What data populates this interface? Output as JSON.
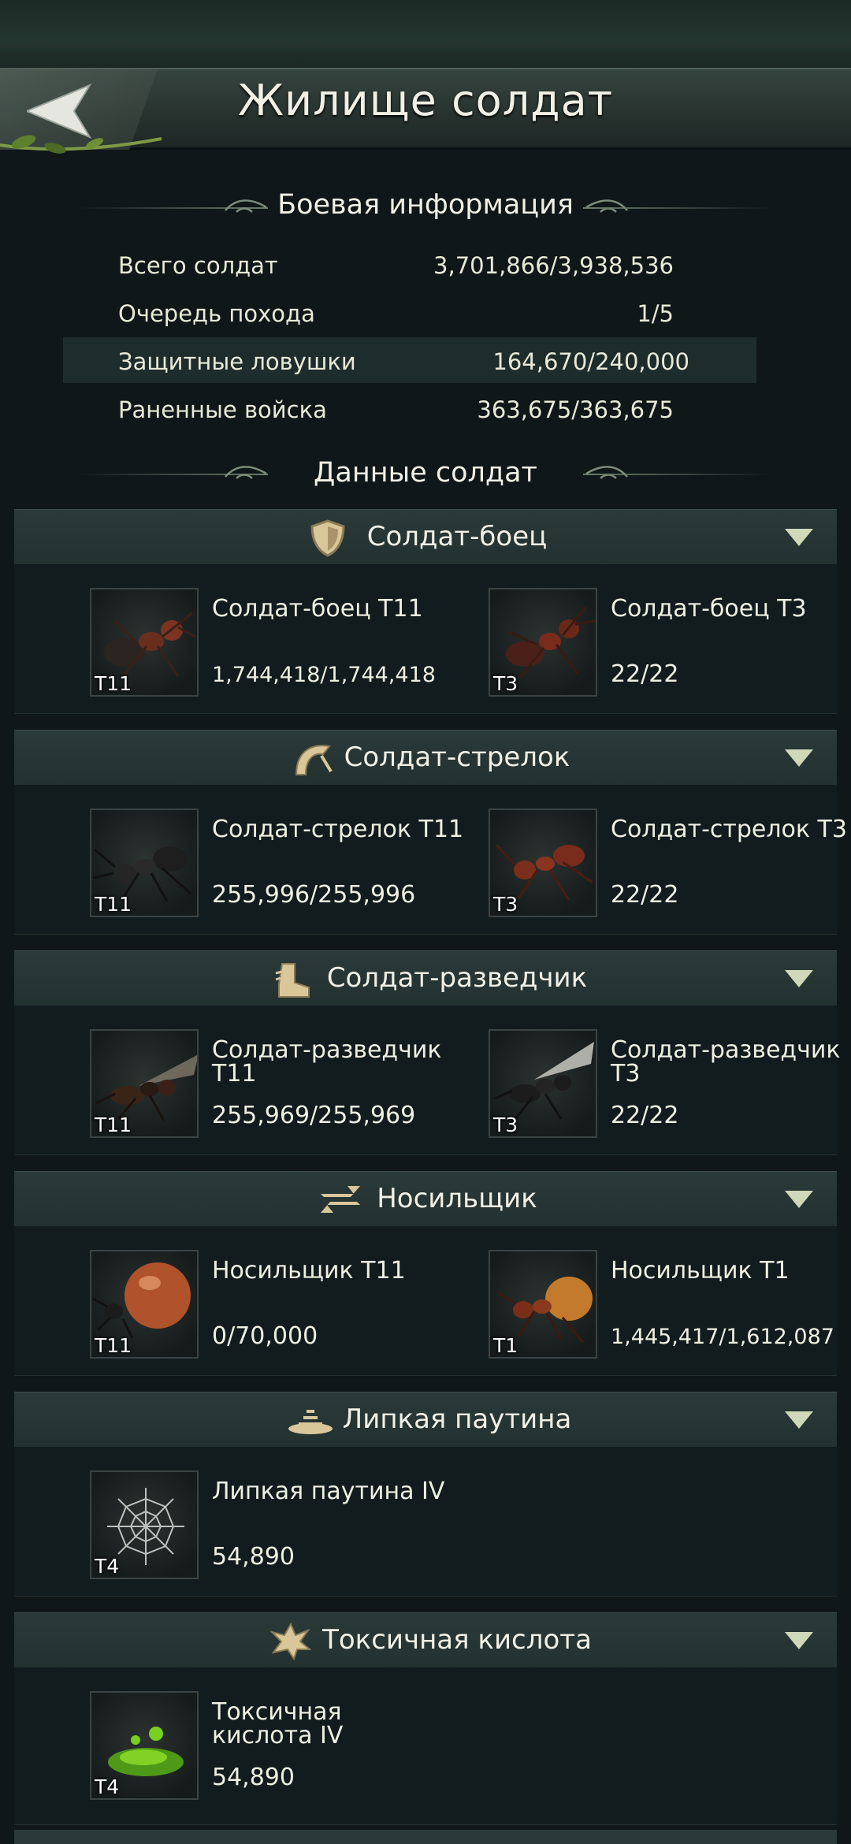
{
  "header": {
    "title": "Жилище солдат",
    "back_icon": "back-arrow-icon"
  },
  "battle_info": {
    "heading": "Боевая информация",
    "rows": [
      {
        "label": "Всего солдат",
        "value": "3,701,866/3,938,536"
      },
      {
        "label": "Очередь похода",
        "value": "1/5"
      },
      {
        "label": "Защитные ловушки",
        "value": "164,670/240,000"
      },
      {
        "label": "Раненные войска",
        "value": "363,675/363,675"
      }
    ]
  },
  "soldier_data": {
    "heading": "Данные солдат"
  },
  "categories": [
    {
      "title": "Солдат-боец",
      "icon": "shield-icon",
      "units": [
        {
          "name": "Солдат-боец T11",
          "count": "1,744,418/1,744,418",
          "tier": "T11"
        },
        {
          "name": "Солдат-боец T3",
          "count": "22/22",
          "tier": "T3"
        }
      ]
    },
    {
      "title": "Солдат-стрелок",
      "icon": "bow-icon",
      "units": [
        {
          "name": "Солдат-стрелок T11",
          "count": "255,996/255,996",
          "tier": "T11"
        },
        {
          "name": "Солдат-стрелок T3",
          "count": "22/22",
          "tier": "T3"
        }
      ]
    },
    {
      "title": "Солдат-разведчик",
      "icon": "boot-icon",
      "units": [
        {
          "name": "Солдат-разведчик T11",
          "count": "255,969/255,969",
          "tier": "T11"
        },
        {
          "name": "Солдат-разведчик T3",
          "count": "22/22",
          "tier": "T3"
        }
      ]
    },
    {
      "title": "Носильщик",
      "icon": "transfer-arrows-icon",
      "units": [
        {
          "name": "Носильщик T11",
          "count": "0/70,000",
          "tier": "T11"
        },
        {
          "name": "Носильщик T1",
          "count": "1,445,417/1,612,087",
          "tier": "T1"
        }
      ]
    },
    {
      "title": "Липкая паутина",
      "icon": "web-trap-icon",
      "units": [
        {
          "name": "Липкая паутина IV",
          "count": "54,890",
          "tier": "T4"
        }
      ]
    },
    {
      "title": "Токсичная кислота",
      "icon": "acid-splash-icon",
      "units": [
        {
          "name": "Токсичная кислота IV",
          "count": "54,890",
          "tier": "T4"
        }
      ]
    }
  ],
  "colors": {
    "background": "#0f1719",
    "header": "#2b3a39",
    "text": "#eef0e2",
    "caret": "#cfd8b8"
  }
}
